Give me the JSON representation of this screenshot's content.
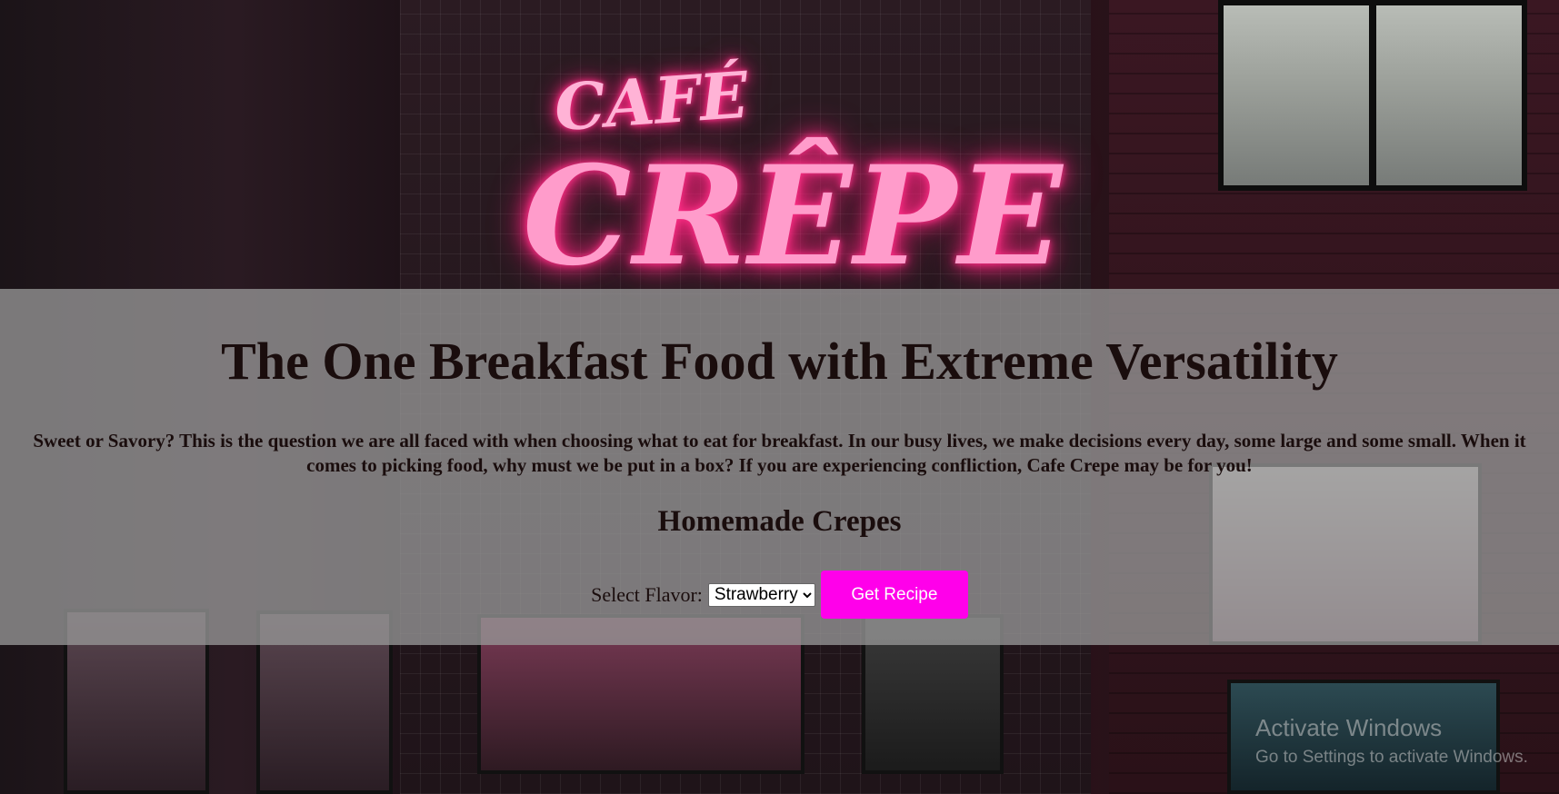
{
  "background": {
    "sign_line1": "CAFÉ",
    "sign_line2": "CRÊPE",
    "neon_color": "#ff2d86"
  },
  "hero": {
    "headline": "The One Breakfast Food with Extreme Versatility",
    "intro": "Sweet or Savory? This is the question we are all faced with when choosing what to eat for breakfast. In our busy lives, we make decisions every day, some large and some small. When it comes to picking food, why must we be put in a box? If you are experiencing confliction, Cafe Crepe may be for you!",
    "subhead": "Homemade Crepes"
  },
  "form": {
    "select_label": "Select Flavor:",
    "selected_flavor": "Strawberry",
    "button_label": "Get Recipe",
    "button_color": "#ff00ea"
  },
  "watermark": {
    "title": "Activate Windows",
    "subtitle": "Go to Settings to activate Windows."
  }
}
